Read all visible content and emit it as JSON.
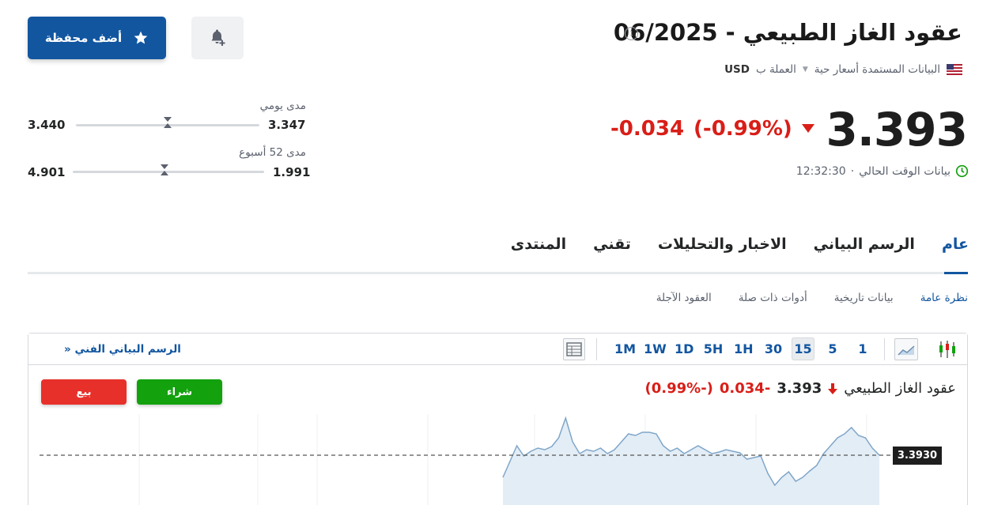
{
  "header": {
    "title": "عقود الغاز الطبيعي - 06/2025",
    "data_source": "البيانات المستمدة أسعار حية",
    "currency_label": "العملة ب",
    "currency_code": "USD",
    "add_portfolio_label": "أضف محفظة"
  },
  "quote": {
    "price": "3.393",
    "change": "-0.034",
    "change_pct": "(-0.99%)",
    "time_label": "بيانات الوقت الحالي",
    "time": "12:32:30"
  },
  "ranges": {
    "daily": {
      "label": "مدى يومي",
      "low": "3.347",
      "high": "3.440",
      "position": 0.5
    },
    "week52": {
      "label": "مدى 52 أسبوع",
      "low": "1.991",
      "high": "4.901",
      "position": 0.52
    }
  },
  "tabs": [
    {
      "label": "عام",
      "active": true
    },
    {
      "label": "الرسم البياني",
      "active": false
    },
    {
      "label": "الاخبار والتحليلات",
      "active": false
    },
    {
      "label": "تقني",
      "active": false
    },
    {
      "label": "المنتدى",
      "active": false
    }
  ],
  "subtabs": [
    {
      "label": "نظرة عامة",
      "active": true
    },
    {
      "label": "بيانات تاريخية",
      "active": false
    },
    {
      "label": "أدوات ذات صلة",
      "active": false
    },
    {
      "label": "العقود الآجلة",
      "active": false
    }
  ],
  "chart": {
    "tech_chart_link": "الرسم البياني الفني",
    "timeframes": [
      "1",
      "5",
      "15",
      "30",
      "1H",
      "5H",
      "1D",
      "1W",
      "1M"
    ],
    "active_timeframe": "15",
    "buy_label": "شراء",
    "sell_label": "بيع",
    "quote_name": "عقود الغاز الطبيعي",
    "quote_price": "3.393",
    "quote_change": "-0.034",
    "quote_change_pct": "(-0.99%)",
    "last_price_tag": "3.3930",
    "colors": {
      "line": "#7fa6c9",
      "fill": "#e3edf6",
      "sell": "#e8302b",
      "buy": "#13a10e",
      "accent": "#1256a0"
    }
  },
  "chart_data": {
    "type": "area",
    "x": [
      0,
      1,
      2,
      3,
      4,
      5,
      6,
      7,
      8,
      9,
      10,
      11,
      12,
      13,
      14,
      15,
      16,
      17,
      18,
      19,
      20,
      21,
      22,
      23,
      24,
      25,
      26,
      27,
      28,
      29,
      30,
      31,
      32,
      33,
      34,
      35,
      36,
      37,
      38,
      39,
      40,
      41,
      42,
      43,
      44,
      45,
      46,
      47,
      48,
      49,
      50,
      51,
      52,
      53,
      54
    ],
    "values": [
      3.365,
      3.385,
      3.405,
      3.392,
      3.398,
      3.402,
      3.4,
      3.404,
      3.415,
      3.44,
      3.41,
      3.395,
      3.4,
      3.398,
      3.402,
      3.395,
      3.4,
      3.41,
      3.42,
      3.418,
      3.422,
      3.422,
      3.42,
      3.405,
      3.398,
      3.402,
      3.395,
      3.4,
      3.405,
      3.4,
      3.395,
      3.397,
      3.4,
      3.398,
      3.396,
      3.388,
      3.39,
      3.392,
      3.37,
      3.355,
      3.365,
      3.372,
      3.36,
      3.365,
      3.373,
      3.38,
      3.395,
      3.405,
      3.415,
      3.42,
      3.428,
      3.418,
      3.415,
      3.402,
      3.393
    ],
    "reference_line": 3.393
  }
}
